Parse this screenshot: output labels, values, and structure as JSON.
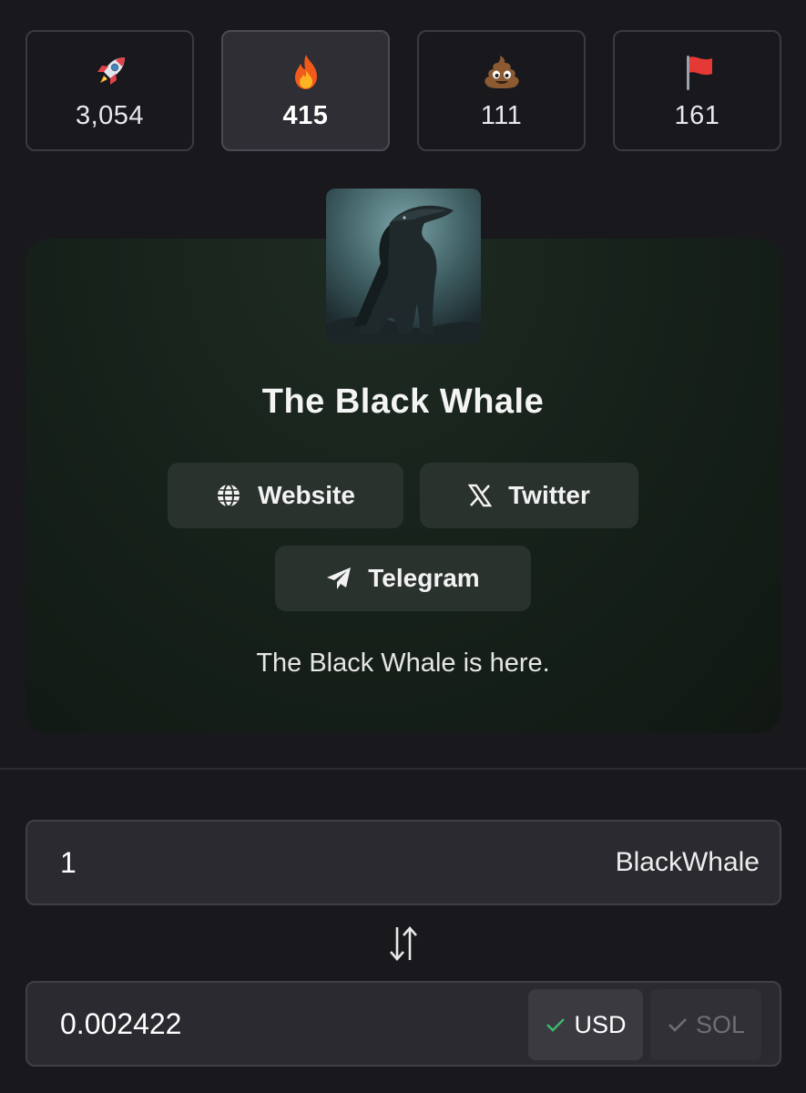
{
  "reactions": [
    {
      "icon": "rocket-icon",
      "count": "3,054",
      "active": false
    },
    {
      "icon": "fire-icon",
      "count": "415",
      "active": true
    },
    {
      "icon": "poop-icon",
      "count": "111",
      "active": false
    },
    {
      "icon": "red-flag-icon",
      "count": "161",
      "active": false
    }
  ],
  "token": {
    "name": "The Black Whale",
    "description": "The Black Whale is here."
  },
  "links": {
    "website": "Website",
    "twitter": "Twitter",
    "telegram": "Telegram"
  },
  "converter": {
    "token_amount": "1",
    "token_symbol": "BlackWhale",
    "price_value": "0.002422",
    "usd_label": "USD",
    "sol_label": "SOL",
    "selected_currency": "USD"
  },
  "colors": {
    "background": "#18181d",
    "card": "#17221b",
    "check_active": "#3fb56b"
  }
}
